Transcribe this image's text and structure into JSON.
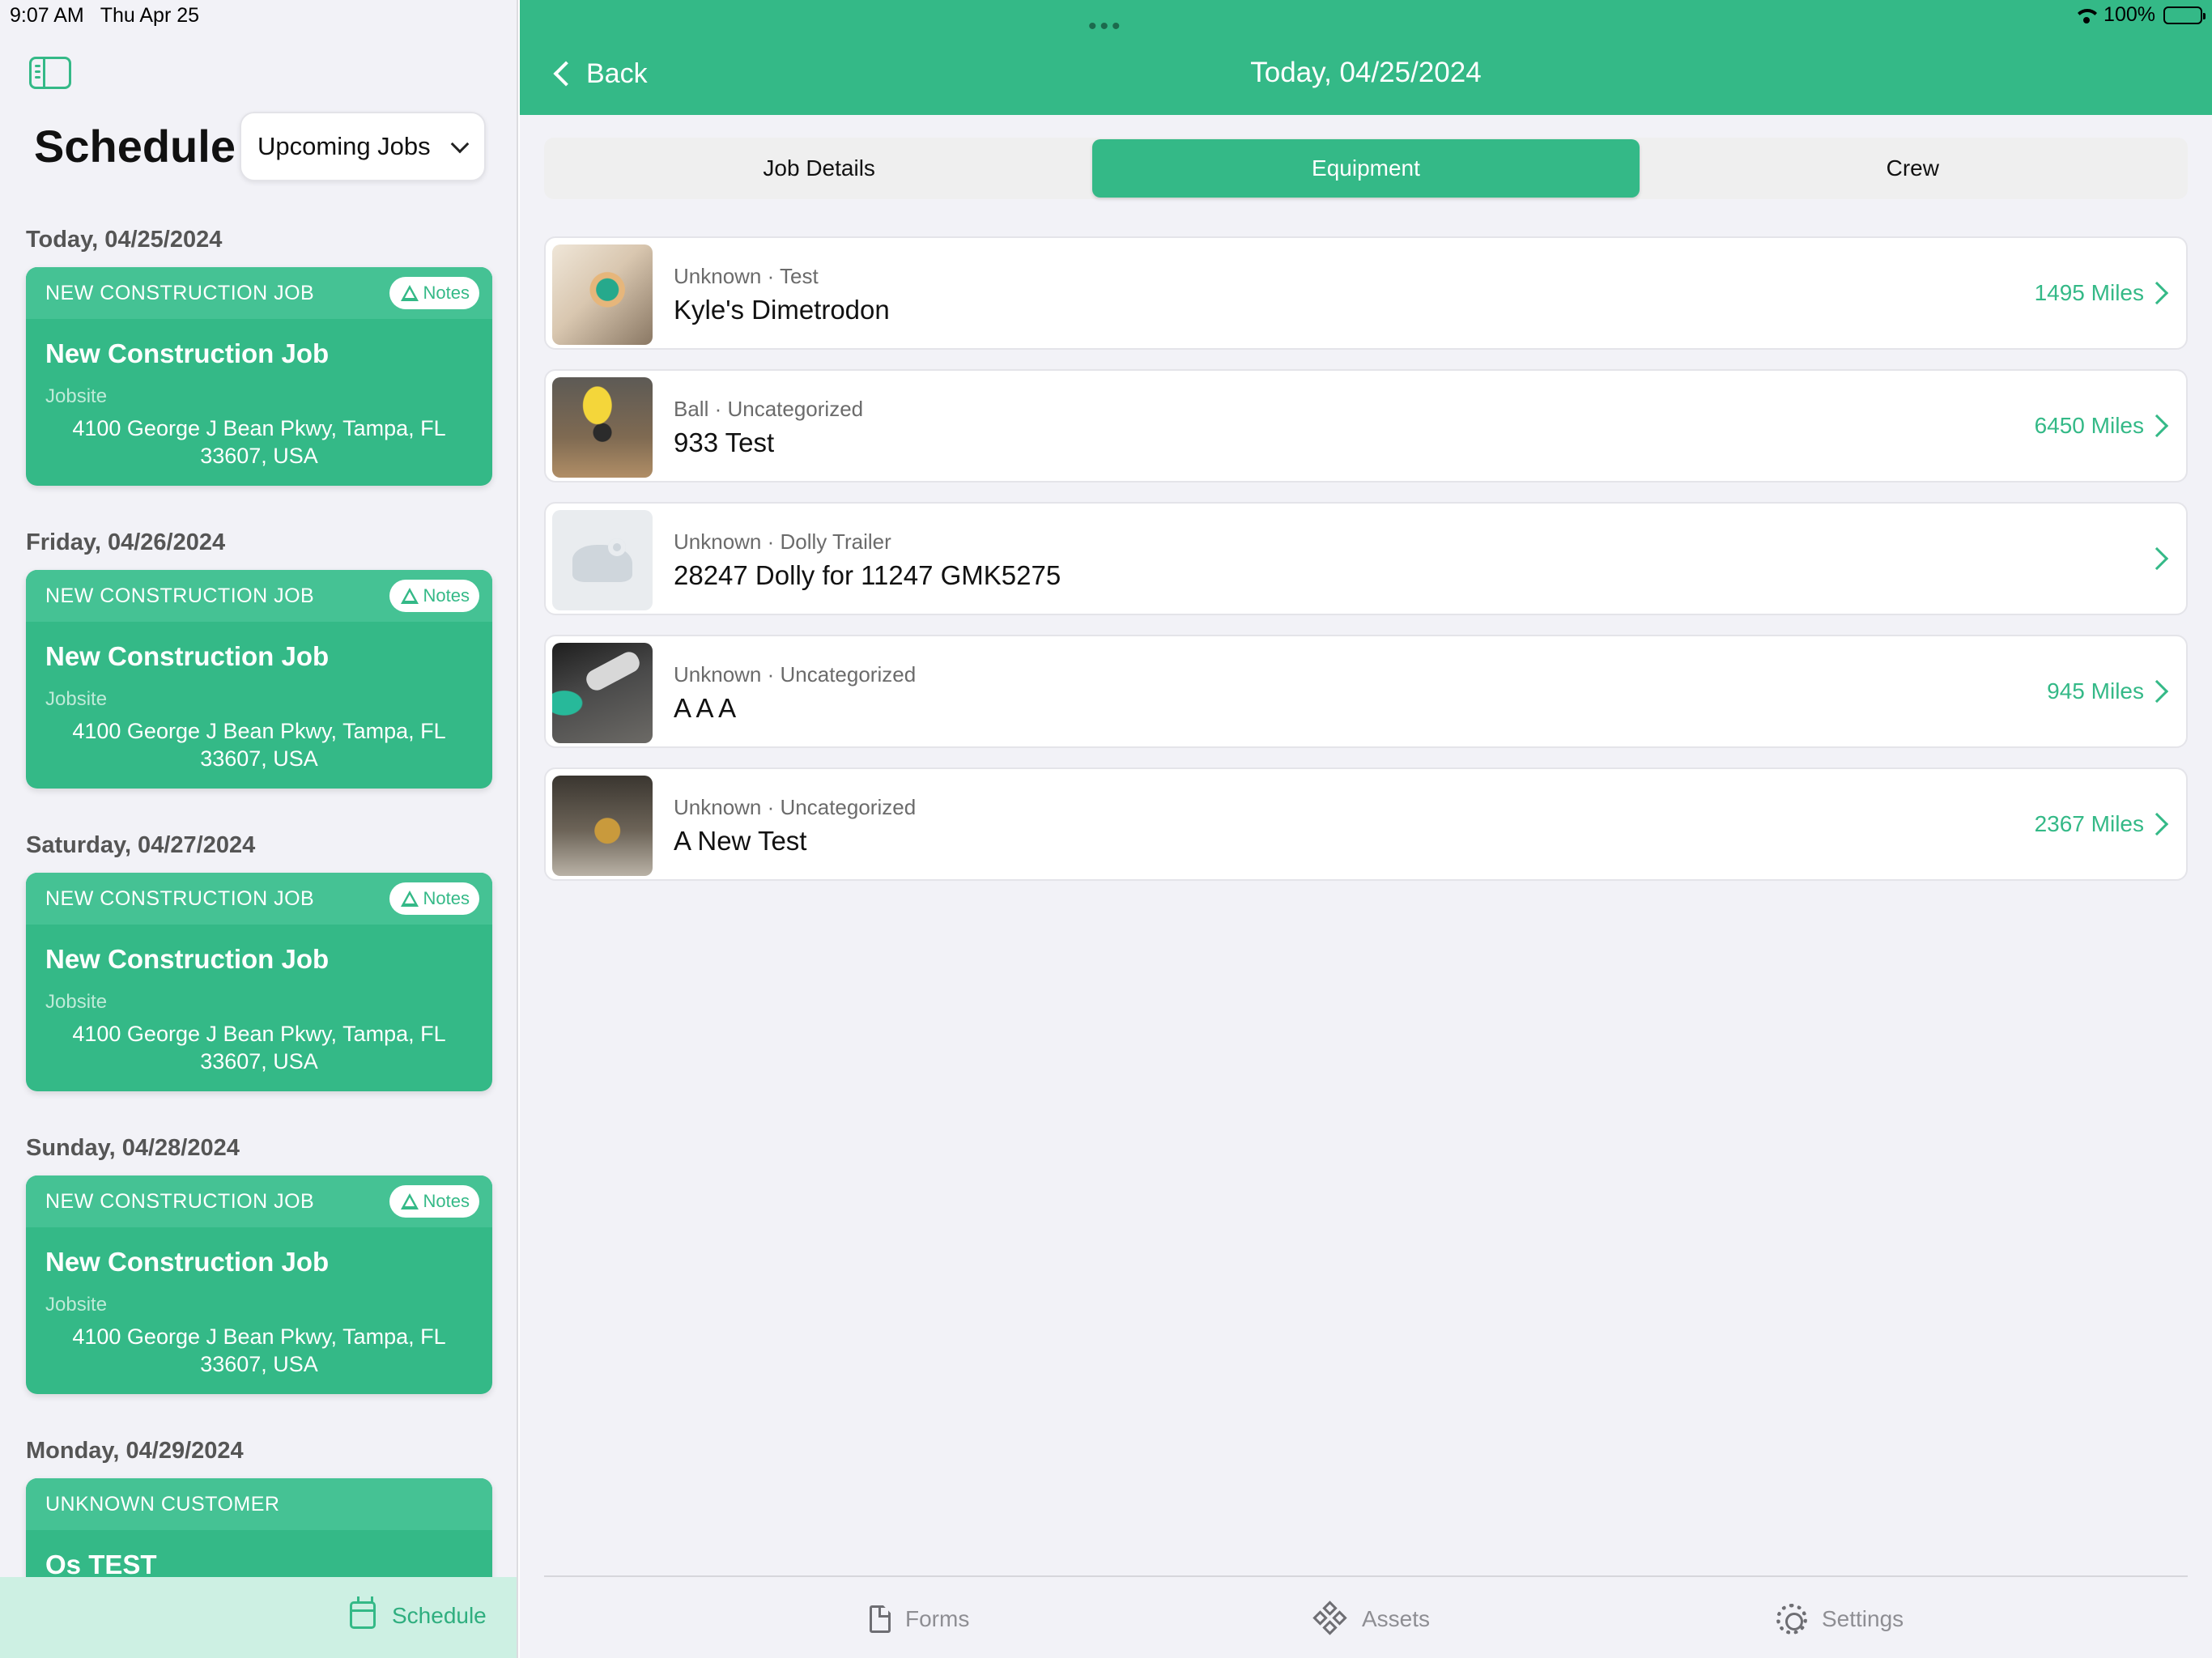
{
  "status_bar": {
    "time": "9:07 AM",
    "date": "Thu Apr 25",
    "battery": "100%"
  },
  "sidebar": {
    "title": "Schedule",
    "filter": {
      "selected": "Upcoming Jobs"
    },
    "days": [
      {
        "date": "Today, 04/25/2024",
        "job": {
          "type": "NEW CONSTRUCTION JOB",
          "badge": "Notes",
          "title": "New Construction Job",
          "location_label": "Jobsite",
          "address": "4100 George J Bean Pkwy, Tampa, FL 33607, USA"
        }
      },
      {
        "date": "Friday, 04/26/2024",
        "job": {
          "type": "NEW CONSTRUCTION JOB",
          "badge": "Notes",
          "title": "New Construction Job",
          "location_label": "Jobsite",
          "address": "4100 George J Bean Pkwy, Tampa, FL 33607, USA"
        }
      },
      {
        "date": "Saturday, 04/27/2024",
        "job": {
          "type": "NEW CONSTRUCTION JOB",
          "badge": "Notes",
          "title": "New Construction Job",
          "location_label": "Jobsite",
          "address": "4100 George J Bean Pkwy, Tampa, FL 33607, USA"
        }
      },
      {
        "date": "Sunday, 04/28/2024",
        "job": {
          "type": "NEW CONSTRUCTION JOB",
          "badge": "Notes",
          "title": "New Construction Job",
          "location_label": "Jobsite",
          "address": "4100 George J Bean Pkwy, Tampa, FL 33607, USA"
        }
      },
      {
        "date": "Monday, 04/29/2024",
        "job": {
          "type": "UNKNOWN CUSTOMER",
          "title": "Os TEST"
        }
      }
    ],
    "tab": {
      "label": "Schedule"
    }
  },
  "header": {
    "back_label": "Back",
    "title": "Today, 04/25/2024"
  },
  "segments": [
    "Job Details",
    "Equipment",
    "Crew"
  ],
  "active_segment": "Equipment",
  "equipment": [
    {
      "meta": "Unknown · Test",
      "name": "Kyle's Dimetrodon",
      "miles": "1495 Miles"
    },
    {
      "meta": "Ball · Uncategorized",
      "name": "933 Test",
      "miles": "6450 Miles"
    },
    {
      "meta": "Unknown · Dolly Trailer",
      "name": "28247 Dolly for 11247 GMK5275",
      "miles": ""
    },
    {
      "meta": "Unknown · Uncategorized",
      "name": "A A A",
      "miles": "945 Miles"
    },
    {
      "meta": "Unknown · Uncategorized",
      "name": "A New Test",
      "miles": "2367 Miles"
    }
  ],
  "tabs": [
    {
      "label": "Forms",
      "icon": "document-icon"
    },
    {
      "label": "Assets",
      "icon": "assets-icon"
    },
    {
      "label": "Settings",
      "icon": "gear-icon"
    }
  ],
  "colors": {
    "accent": "#34b987",
    "card_header": "#45c294",
    "tab_selected_bg": "#cdf0e3"
  }
}
